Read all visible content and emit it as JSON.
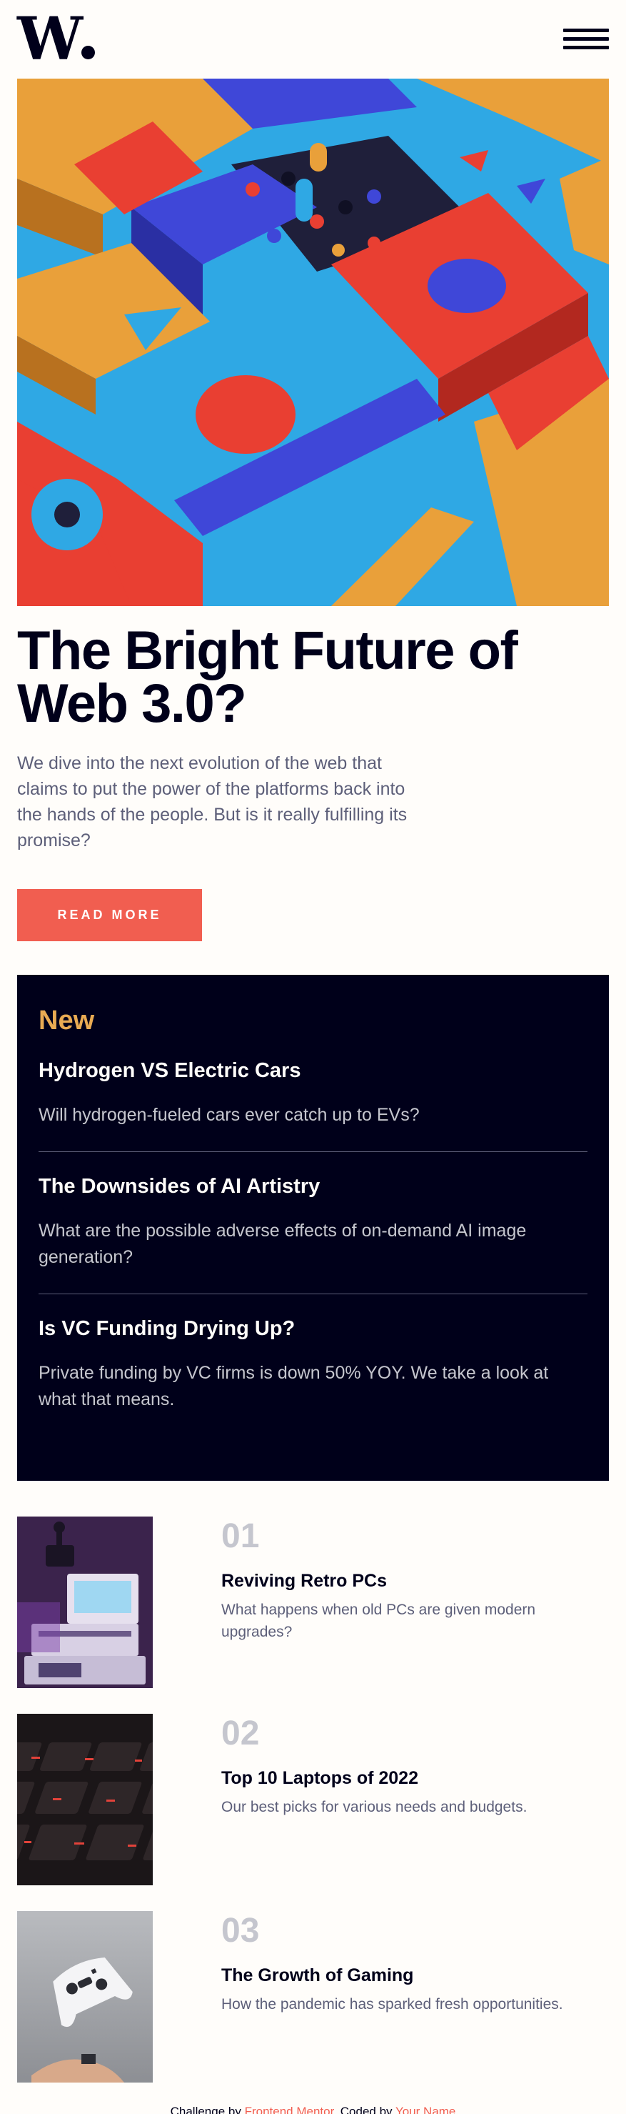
{
  "header": {
    "logo_text": "W",
    "menu_icon": "hamburger-menu-icon"
  },
  "hero": {
    "image_alt": "colorful 3D geometric blocks"
  },
  "main": {
    "title": "The Bright Future of Web 3.0?",
    "intro": "We dive into the next evolution of the web that claims to put the power of the platforms back into the hands of the people. But is it really fulfilling its promise?",
    "read_more_label": "READ MORE"
  },
  "new_panel": {
    "heading": "New",
    "items": [
      {
        "title": "Hydrogen VS Electric Cars",
        "text": "Will hydrogen-fueled cars ever catch up to EVs?"
      },
      {
        "title": "The Downsides of AI Artistry",
        "text": "What are the possible adverse effects of on-demand AI image generation?"
      },
      {
        "title": "Is VC Funding Drying Up?",
        "text": "Private funding by VC firms is down 50% YOY. We take a look at what that means."
      }
    ]
  },
  "articles": [
    {
      "num": "01",
      "title": "Reviving Retro PCs",
      "desc": "What happens when old PCs are given modern upgrades?"
    },
    {
      "num": "02",
      "title": "Top 10 Laptops of 2022",
      "desc": "Our best picks for various needs and budgets."
    },
    {
      "num": "03",
      "title": "The Growth of Gaming",
      "desc": "How the pandemic has sparked fresh opportunities."
    }
  ],
  "footer": {
    "prefix": "Challenge by ",
    "challenge_link": "Frontend Mentor",
    "middle": ". Coded by ",
    "author_link": "Your Name"
  },
  "colors": {
    "accent": "#f15e50",
    "dark": "#00001a",
    "new_heading": "#e9ab53",
    "muted": "#5d5f79"
  }
}
